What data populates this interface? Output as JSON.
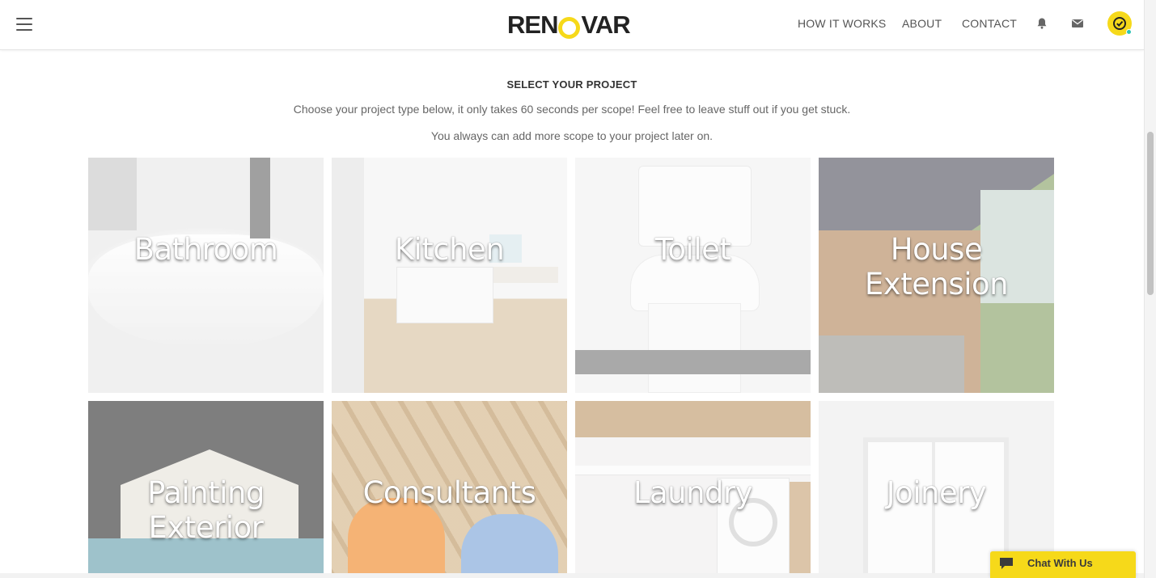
{
  "header": {
    "logo_text_left": "REN",
    "logo_text_right": "VAR",
    "nav": [
      {
        "label": "HOW IT WORKS"
      },
      {
        "label": "ABOUT"
      },
      {
        "label": "CONTACT"
      }
    ],
    "icons": [
      "menu-icon",
      "bell-icon",
      "mail-icon",
      "user-avatar-icon"
    ],
    "brand_color": "#f6d91a"
  },
  "intro": {
    "title": "SELECT YOUR PROJECT",
    "line1": "Choose your project type below, it only takes 60 seconds per scope! Feel free to leave stuff out if you get stuck.",
    "line2": "You always can add more scope to your project later on."
  },
  "projects": [
    {
      "label": "Bathroom"
    },
    {
      "label": "Kitchen"
    },
    {
      "label": "Toilet"
    },
    {
      "label": "House Extension"
    },
    {
      "label": "Painting Exterior"
    },
    {
      "label": "Consultants"
    },
    {
      "label": "Laundry"
    },
    {
      "label": "Joinery"
    }
  ],
  "chat": {
    "label": "Chat With Us"
  }
}
